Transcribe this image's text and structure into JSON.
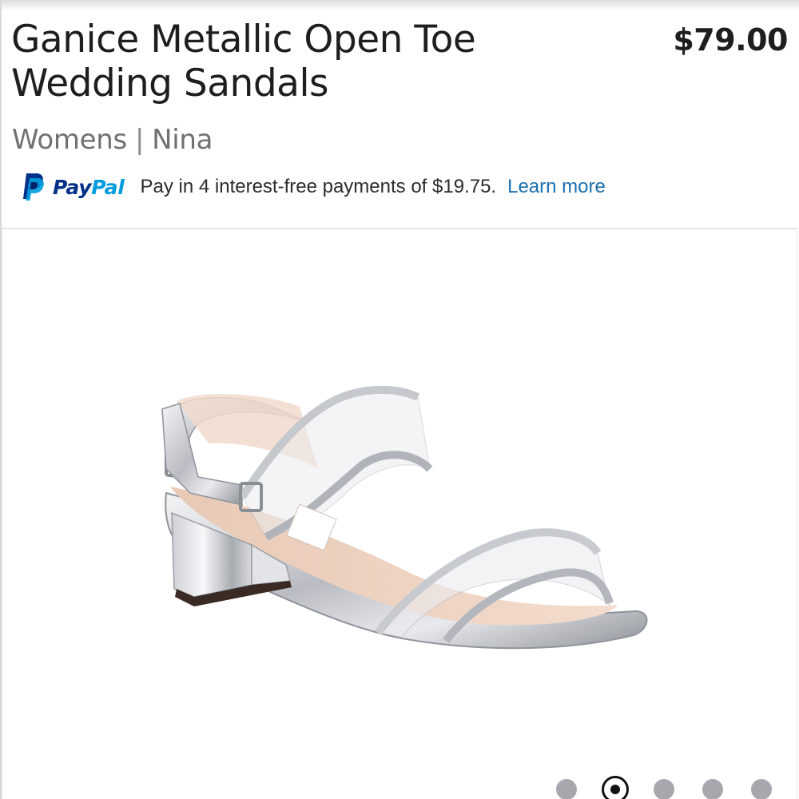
{
  "product": {
    "title": "Ganice Metallic Open Toe Wedding Sandals",
    "price": "$79.00",
    "category": "Womens",
    "separator": "|",
    "brand": "Nina"
  },
  "paypal": {
    "logo_text_pay": "Pay",
    "logo_text_pal": "Pal",
    "message": "Pay in 4 interest-free payments of $19.75.",
    "link_label": "Learn more",
    "colors": {
      "dark_blue": "#003087",
      "light_blue": "#009cde",
      "link": "#1a6fb0"
    }
  },
  "gallery": {
    "image_icon": "silver-sandal-photo",
    "image_count": 5,
    "active_index": 1
  },
  "colors": {
    "text": "#1e1e1e",
    "muted": "#707070",
    "dot_inactive": "#a7a7ad",
    "dot_active": "#111111"
  }
}
